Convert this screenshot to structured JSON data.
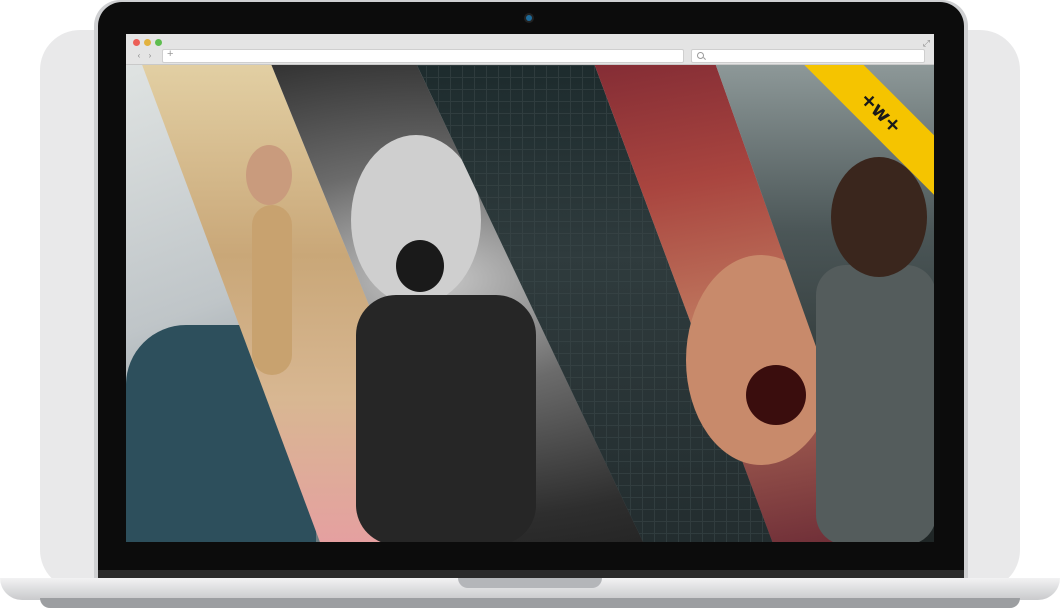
{
  "browser": {
    "window_controls": [
      "close",
      "minimize",
      "maximize"
    ],
    "nav": {
      "back_icon": "‹",
      "forward_icon": "›"
    },
    "address_bar": {
      "icon": "+",
      "value": ""
    },
    "search_bar": {
      "icon": "search-icon",
      "value": ""
    },
    "expand_icon": "⤢"
  },
  "hero": {
    "badge_text": "+w+"
  },
  "colors": {
    "badge": "#f5c400",
    "close": "#ec5f57",
    "minimize": "#e2b23f",
    "maximize": "#5ebd4f"
  }
}
